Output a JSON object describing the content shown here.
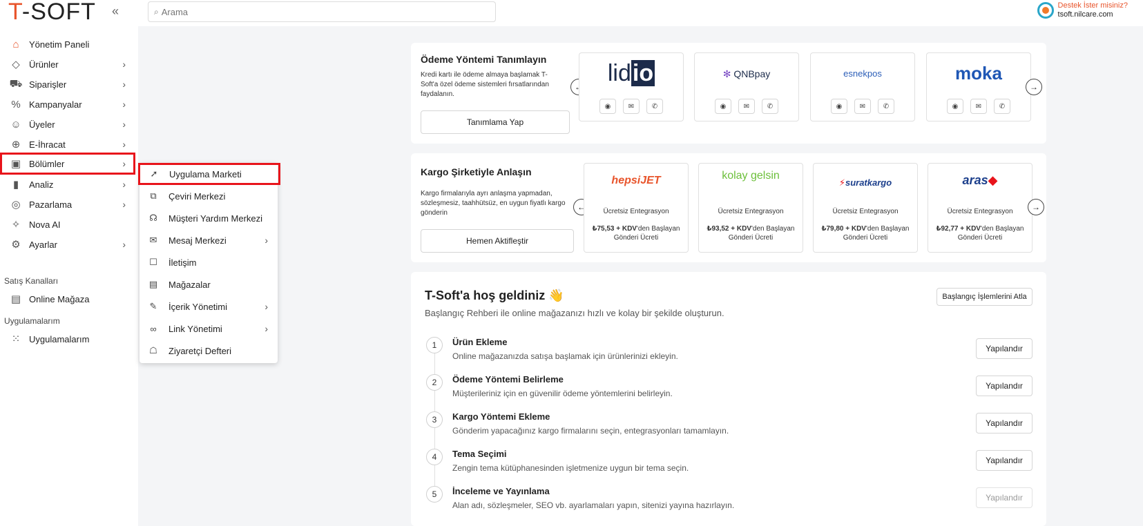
{
  "header": {
    "logo_t": "T",
    "logo_rest": "-SOFT",
    "collapse_icon": "«",
    "search_placeholder": "Arama",
    "support_line1": "Destek İster misiniz?",
    "support_line2": "tsoft.nilcare.com"
  },
  "sidebar": {
    "items": [
      {
        "label": "Yönetim Paneli",
        "icon": "home-icon",
        "glyph": "⌂"
      },
      {
        "label": "Ürünler",
        "icon": "tag-icon",
        "glyph": "◇"
      },
      {
        "label": "Siparişler",
        "icon": "cart-icon",
        "glyph": "⛟"
      },
      {
        "label": "Kampanyalar",
        "icon": "percent-icon",
        "glyph": "%"
      },
      {
        "label": "Üyeler",
        "icon": "users-icon",
        "glyph": "☺"
      },
      {
        "label": "E-İhracat",
        "icon": "globe-icon",
        "glyph": "⊕"
      },
      {
        "label": "Bölümler",
        "icon": "store-icon",
        "glyph": "▣"
      },
      {
        "label": "Analiz",
        "icon": "chart-icon",
        "glyph": "▮"
      },
      {
        "label": "Pazarlama",
        "icon": "target-icon",
        "glyph": "◎"
      },
      {
        "label": "Nova AI",
        "icon": "sparkle-icon",
        "glyph": "✧"
      },
      {
        "label": "Ayarlar",
        "icon": "gear-icon",
        "glyph": "⚙"
      }
    ],
    "section_sales": "Satış Kanalları",
    "online_store": "Online Mağaza",
    "section_apps": "Uygulamalarım",
    "apps": "Uygulamalarım"
  },
  "submenu": {
    "items": [
      {
        "label": "Uygulama Marketi",
        "glyph": "➚",
        "has_children": false
      },
      {
        "label": "Çeviri Merkezi",
        "glyph": "⧉",
        "has_children": false
      },
      {
        "label": "Müşteri Yardım Merkezi",
        "glyph": "☊",
        "has_children": false
      },
      {
        "label": "Mesaj Merkezi",
        "glyph": "✉",
        "has_children": true
      },
      {
        "label": "İletişim",
        "glyph": "☐",
        "has_children": false
      },
      {
        "label": "Mağazalar",
        "glyph": "▤",
        "has_children": false
      },
      {
        "label": "İçerik Yönetimi",
        "glyph": "✎",
        "has_children": true
      },
      {
        "label": "Link Yönetimi",
        "glyph": "∞",
        "has_children": true
      },
      {
        "label": "Ziyaretçi Defteri",
        "glyph": "☖",
        "has_children": false
      }
    ]
  },
  "payment": {
    "title": "Ödeme Yöntemi Tanımlayın",
    "desc": "Kredi kartı ile ödeme almaya başlamak T-Soft'a özel ödeme sistemleri fırsatlarından faydalanın.",
    "button": "Tanımlama Yap",
    "providers": [
      "lidio",
      "QNBpay",
      "esnekpos",
      "moka"
    ]
  },
  "cargo": {
    "title": "Kargo Şirketiyle Anlaşın",
    "desc": "Kargo firmalarıyla ayrı anlaşma yapmadan, sözleşmesiz, taahhütsüz, en uygun fiyatlı kargo gönderin",
    "button": "Hemen Aktifleştir",
    "tile_subtitle": "Ücretsiz Entegrasyon",
    "kdv": "+ KDV",
    "price_suffix": "'den Başlayan Gönderi Ücreti",
    "providers": [
      {
        "name": "hepsiJET",
        "price": "₺75,53"
      },
      {
        "name": "kolay gelsin",
        "price": "₺93,52"
      },
      {
        "name": "suratkargo",
        "price": "₺79,80"
      },
      {
        "name": "aras",
        "price": "₺92,77"
      }
    ]
  },
  "welcome": {
    "title": "T-Soft'a hoş geldiniz 👋",
    "subtitle": "Başlangıç Rehberi ile online mağazanızı hızlı ve kolay bir şekilde oluşturun.",
    "skip_button": "Başlangıç İşlemlerini Atla",
    "steps": [
      {
        "num": "1",
        "title": "Ürün Ekleme",
        "desc": "Online mağazanızda satışa başlamak için ürünlerinizi ekleyin.",
        "button": "Yapılandır"
      },
      {
        "num": "2",
        "title": "Ödeme Yöntemi Belirleme",
        "desc": "Müşterileriniz için en güvenilir ödeme yöntemlerini belirleyin.",
        "button": "Yapılandır"
      },
      {
        "num": "3",
        "title": "Kargo Yöntemi Ekleme",
        "desc": "Gönderim yapacağınız kargo firmalarını seçin, entegrasyonları tamamlayın.",
        "button": "Yapılandır"
      },
      {
        "num": "4",
        "title": "Tema Seçimi",
        "desc": "Zengin tema kütüphanesinden işletmenize uygun bir tema seçin.",
        "button": "Yapılandır"
      },
      {
        "num": "5",
        "title": "İnceleme ve Yayınlama",
        "desc": "Alan adı, sözleşmeler, SEO vb. ayarlamaları yapın, sitenizi yayına hazırlayın.",
        "button": "Yapılandır"
      }
    ]
  },
  "colors": {
    "accent": "#e8542b",
    "highlight_outline": "#e8141b"
  }
}
